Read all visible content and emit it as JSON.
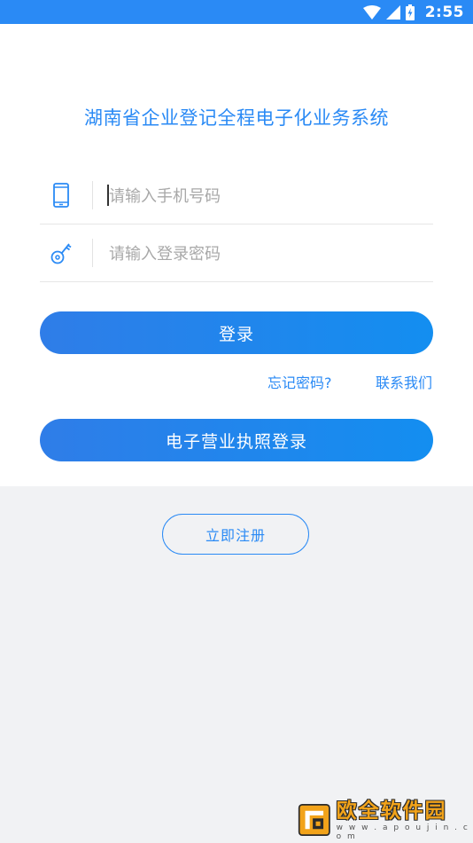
{
  "status_bar": {
    "time": "2:55",
    "icons": [
      "wifi-icon",
      "signal-icon",
      "battery-icon"
    ]
  },
  "login": {
    "title": "湖南省企业登记全程电子化业务系统",
    "phone_field": {
      "placeholder": "请输入手机号码",
      "value": "",
      "icon": "phone-icon"
    },
    "password_field": {
      "placeholder": "请输入登录密码",
      "value": "",
      "icon": "key-icon"
    },
    "login_button": "登录",
    "forgot_password": "忘记密码?",
    "contact_us": "联系我们",
    "license_login_button": "电子营业执照登录",
    "register_button": "立即注册"
  },
  "watermark": {
    "title": "欧全软件园",
    "url": "w w w . a p o u j i n . c o m"
  },
  "colors": {
    "primary": "#2a8af5",
    "gradient_start": "#2f7de8",
    "gradient_end": "#138ef0",
    "background_gray": "#f1f2f4",
    "watermark_orange": "#f2a31a"
  }
}
